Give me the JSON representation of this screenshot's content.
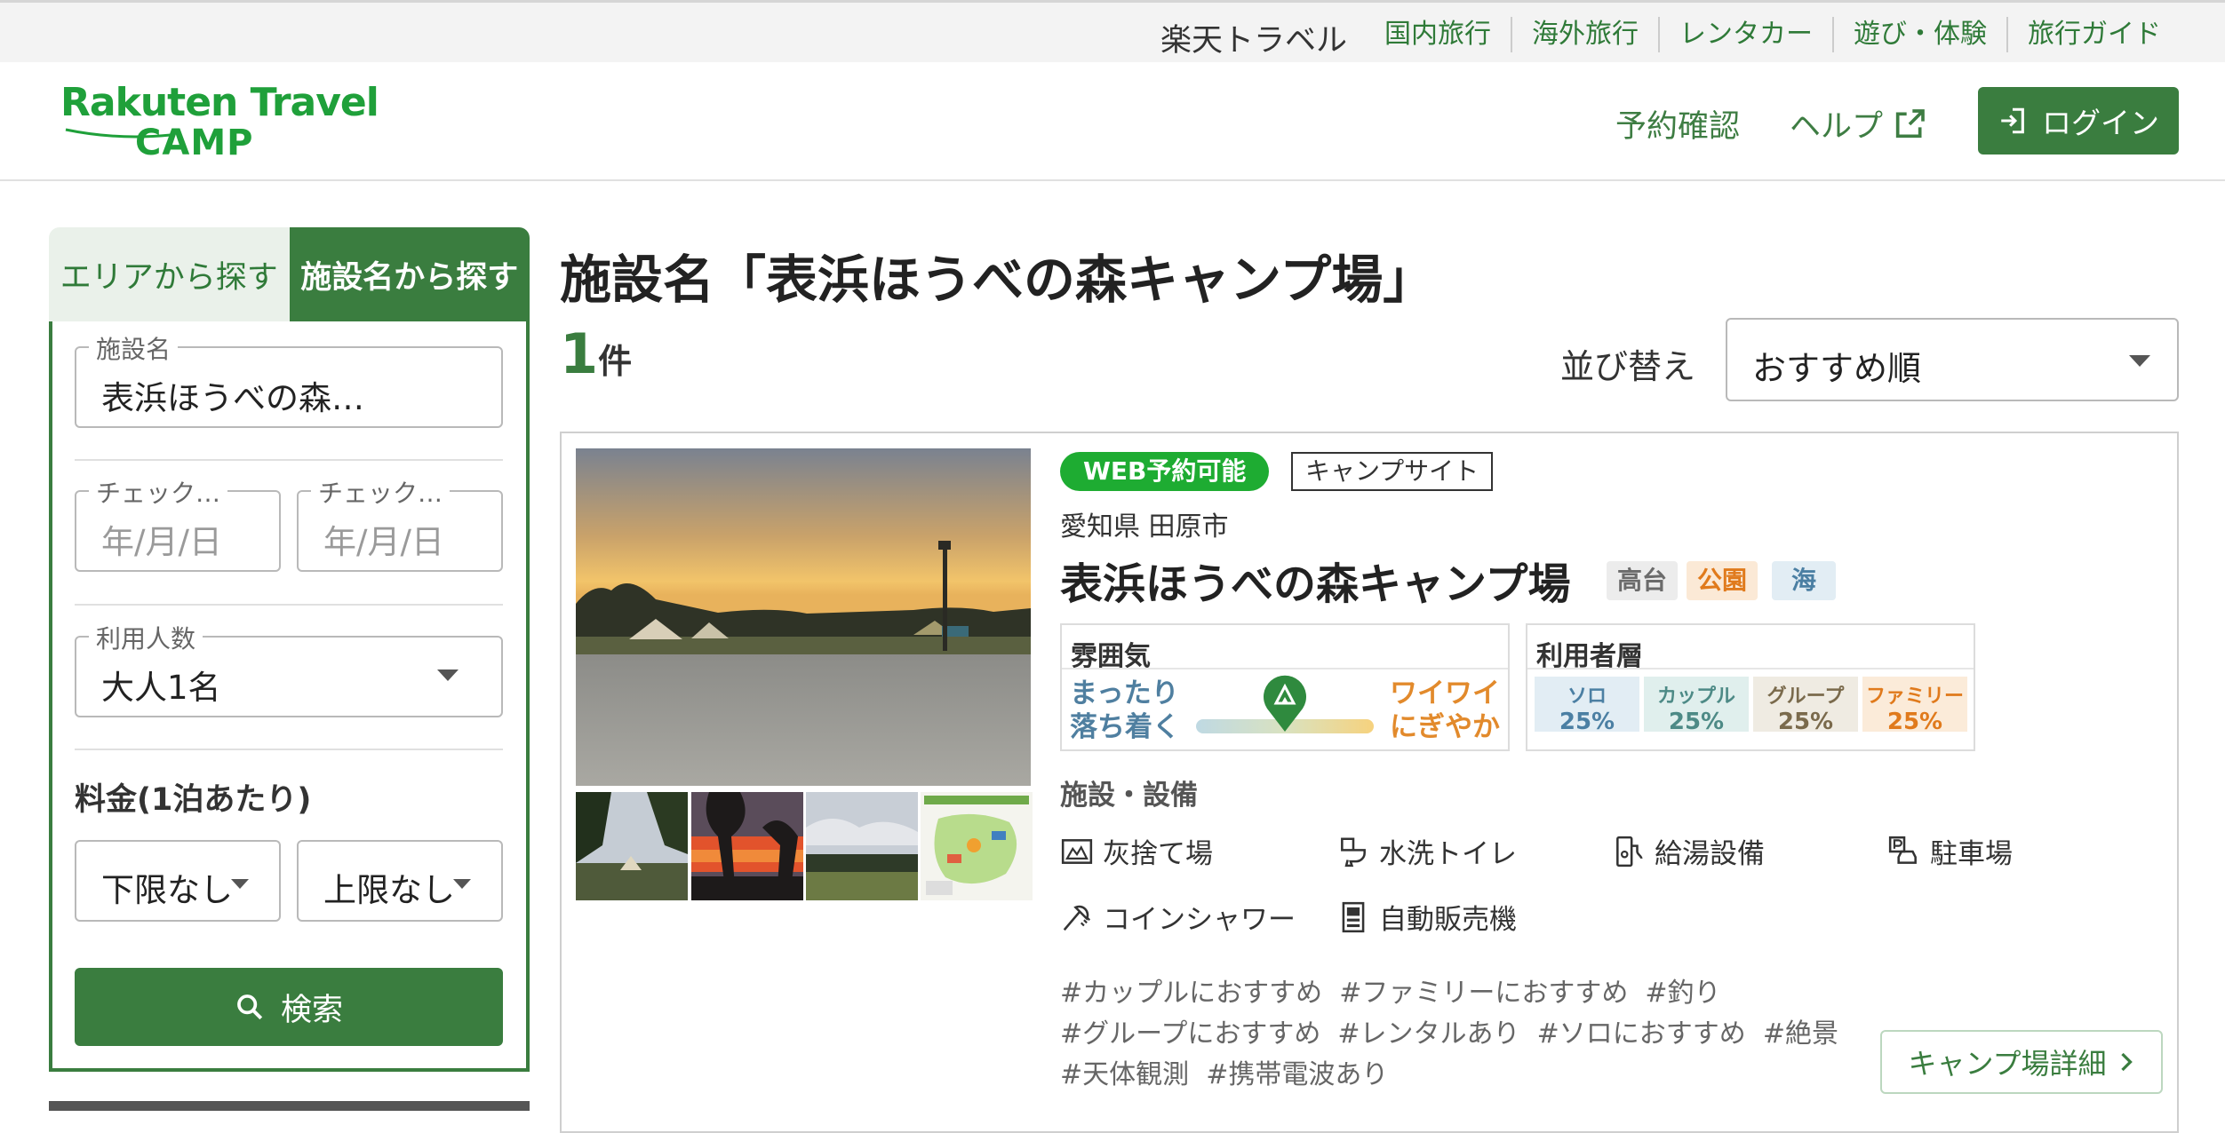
{
  "topbar": {
    "brand": "楽天トラベル",
    "links": [
      "国内旅行",
      "海外旅行",
      "レンタカー",
      "遊び・体験",
      "旅行ガイド"
    ]
  },
  "header": {
    "logo_line1": "Rakuten Travel",
    "logo_line2": "CAMP",
    "reservation_link": "予約確認",
    "help_link": "ヘルプ",
    "login_label": "ログイン"
  },
  "sidebar": {
    "tab_area": "エリアから探す",
    "tab_name": "施設名から探す",
    "facility_label": "施設名",
    "facility_value": "表浜ほうべの森…",
    "checkin_label": "チェック…",
    "checkin_placeholder": "年/月/日",
    "checkout_label": "チェック…",
    "checkout_placeholder": "年/月/日",
    "guests_label": "利用人数",
    "guests_value": "大人1名",
    "price_label": "料金(1泊あたり)",
    "price_min": "下限なし",
    "price_max": "上限なし",
    "search_label": "検索"
  },
  "main": {
    "title": "施設名「表浜ほうべの森キャンプ場」",
    "count": "1",
    "count_unit": "件",
    "sort_label": "並び替え",
    "sort_value": "おすすめ順"
  },
  "result": {
    "badge_web": "WEB予約可能",
    "badge_type": "キャンプサイト",
    "location": "愛知県 田原市",
    "name": "表浜ほうべの森キャンプ場",
    "tags": [
      {
        "label": "高台",
        "color": "#6b6b6b",
        "bg": "#ececec"
      },
      {
        "label": "公園",
        "color": "#e07a1c",
        "bg": "#fbe9d6"
      },
      {
        "label": "海",
        "color": "#4b7fa3",
        "bg": "#e2edf4"
      }
    ],
    "mood_title": "雰囲気",
    "mood_left_1": "まったり",
    "mood_left_2": "落ち着く",
    "mood_right_1": "ワイワイ",
    "mood_right_2": "にぎやか",
    "mood_level": 0.5,
    "users_title": "利用者層",
    "users": [
      {
        "label": "ソロ",
        "pct": "25%",
        "color": "#4b7fa3",
        "bg": "#e2edf4"
      },
      {
        "label": "カップル",
        "pct": "25%",
        "color": "#4d8a86",
        "bg": "#e0efed"
      },
      {
        "label": "グループ",
        "pct": "25%",
        "color": "#7a6a4c",
        "bg": "#efebe2"
      },
      {
        "label": "ファミリー",
        "pct": "25%",
        "color": "#e07a1c",
        "bg": "#fbebd9"
      }
    ],
    "amenities_title": "施設・設備",
    "amenities": [
      {
        "label": "灰捨て場",
        "icon": "ash-disposal-icon"
      },
      {
        "label": "水洗トイレ",
        "icon": "flush-toilet-icon"
      },
      {
        "label": "給湯設備",
        "icon": "hot-water-icon"
      },
      {
        "label": "駐車場",
        "icon": "parking-icon"
      },
      {
        "label": "コインシャワー",
        "icon": "coin-shower-icon"
      },
      {
        "label": "自動販売機",
        "icon": "vending-machine-icon"
      }
    ],
    "hashtags_line1": "#カップルにおすすめ  #ファミリーにおすすめ  #釣り",
    "hashtags_line2": "#グループにおすすめ  #レンタルあり  #ソロにおすすめ  #絶景",
    "hashtags_line3": "#天体観測  #携帯電波あり",
    "detail_label": "キャンプ場詳細"
  },
  "colors": {
    "brand_green": "#3a7d3f",
    "logo_green": "#1fa03a",
    "web_badge": "#1eac32"
  }
}
